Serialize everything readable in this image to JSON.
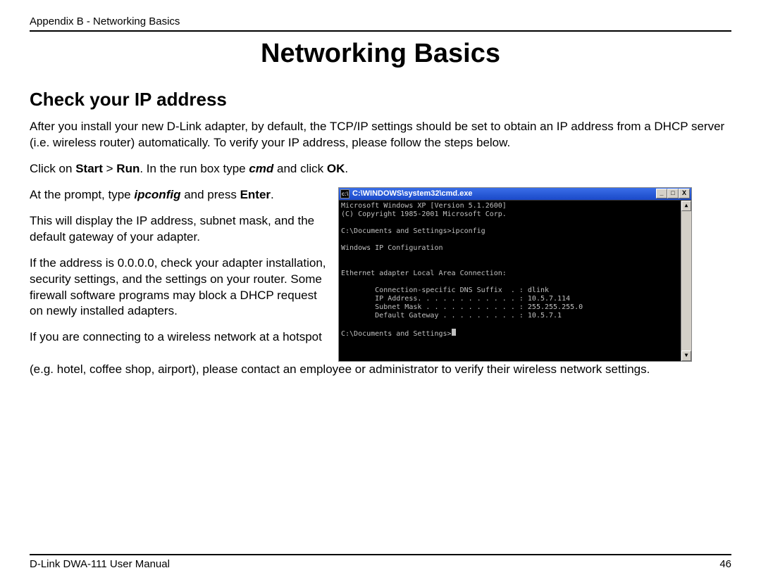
{
  "header": {
    "label": "Appendix B - Networking Basics"
  },
  "title": "Networking Basics",
  "subtitle": "Check your IP address",
  "paragraphs": {
    "intro": "After you install your new D-Link adapter, by default, the TCP/IP settings should be set to obtain an IP address from a DHCP server (i.e. wireless router) automatically. To verify your IP address, please follow the steps below.",
    "step1_before": "Click on ",
    "step1_bold1": "Start",
    "step1_gt": " > ",
    "step1_bold2": "Run",
    "step1_mid1": ". In the run box type ",
    "step1_italic": "cmd",
    "step1_mid2": " and click ",
    "step1_bold3": "OK",
    "step1_end": ".",
    "step2_before": "At the prompt, type ",
    "step2_italic": "ipconfig",
    "step2_mid": " and press ",
    "step2_bold": "Enter",
    "step2_end": ".",
    "p3": "This will display the IP address, subnet mask, and the default gateway of your adapter.",
    "p4": "If the address is 0.0.0.0, check your adapter installation, security settings, and the settings on your router. Some firewall software programs may block a DHCP request on newly installed adapters.",
    "p5a": "If you are connecting to a wireless network at a hotspot",
    "p5b": "(e.g. hotel, coffee shop, airport), please contact an employee or administrator to verify their wireless network settings."
  },
  "cmd_window": {
    "title": "C:\\WINDOWS\\system32\\cmd.exe",
    "icon_text": "c:\\",
    "minimize": "_",
    "maximize": "□",
    "close": "X",
    "scroll_up": "▲",
    "scroll_down": "▼",
    "lines": "Microsoft Windows XP [Version 5.1.2600]\n(C) Copyright 1985-2001 Microsoft Corp.\n\nC:\\Documents and Settings>ipconfig\n\nWindows IP Configuration\n\n\nEthernet adapter Local Area Connection:\n\n        Connection-specific DNS Suffix  . : dlink\n        IP Address. . . . . . . . . . . . : 10.5.7.114\n        Subnet Mask . . . . . . . . . . . : 255.255.255.0\n        Default Gateway . . . . . . . . . : 10.5.7.1\n\nC:\\Documents and Settings>"
  },
  "footer": {
    "left": "D-Link DWA-111 User Manual",
    "right": "46"
  }
}
